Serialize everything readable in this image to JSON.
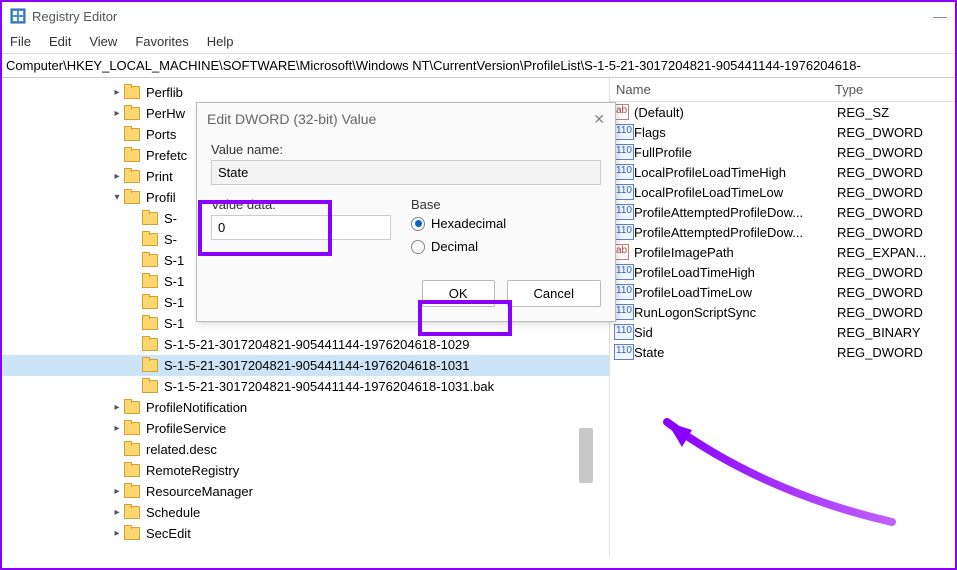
{
  "titlebar": {
    "title": "Registry Editor"
  },
  "menu": {
    "file": "File",
    "edit": "Edit",
    "view": "View",
    "favorites": "Favorites",
    "help": "Help"
  },
  "addressbar": "Computer\\HKEY_LOCAL_MACHINE\\SOFTWARE\\Microsoft\\Windows NT\\CurrentVersion\\ProfileList\\S-1-5-21-3017204821-905441144-1976204618-",
  "tree": {
    "items": [
      {
        "label": "Perflib",
        "indent": 6,
        "chevron": "right"
      },
      {
        "label": "PerHw",
        "indent": 6,
        "chevron": "right"
      },
      {
        "label": "Ports",
        "indent": 6,
        "chevron": ""
      },
      {
        "label": "Prefetc",
        "indent": 6,
        "chevron": ""
      },
      {
        "label": "Print",
        "indent": 6,
        "chevron": "right"
      },
      {
        "label": "Profil",
        "indent": 6,
        "chevron": "down"
      },
      {
        "label": "S-",
        "indent": 7,
        "chevron": ""
      },
      {
        "label": "S-",
        "indent": 7,
        "chevron": ""
      },
      {
        "label": "S-1",
        "indent": 7,
        "chevron": ""
      },
      {
        "label": "S-1",
        "indent": 7,
        "chevron": ""
      },
      {
        "label": "S-1",
        "indent": 7,
        "chevron": ""
      },
      {
        "label": "S-1",
        "indent": 7,
        "chevron": ""
      },
      {
        "label": "S-1-5-21-3017204821-905441144-1976204618-1029",
        "indent": 7,
        "chevron": ""
      },
      {
        "label": "S-1-5-21-3017204821-905441144-1976204618-1031",
        "indent": 7,
        "chevron": "",
        "selected": true
      },
      {
        "label": "S-1-5-21-3017204821-905441144-1976204618-1031.bak",
        "indent": 7,
        "chevron": ""
      },
      {
        "label": "ProfileNotification",
        "indent": 6,
        "chevron": "right"
      },
      {
        "label": "ProfileService",
        "indent": 6,
        "chevron": "right"
      },
      {
        "label": "related.desc",
        "indent": 6,
        "chevron": ""
      },
      {
        "label": "RemoteRegistry",
        "indent": 6,
        "chevron": ""
      },
      {
        "label": "ResourceManager",
        "indent": 6,
        "chevron": "right"
      },
      {
        "label": "Schedule",
        "indent": 6,
        "chevron": "right"
      },
      {
        "label": "SecEdit",
        "indent": 6,
        "chevron": "right"
      }
    ]
  },
  "list": {
    "cols": {
      "name": "Name",
      "type": "Type"
    },
    "rows": [
      {
        "icon": "string",
        "name": "(Default)",
        "type": "REG_SZ"
      },
      {
        "icon": "dword",
        "name": "Flags",
        "type": "REG_DWORD"
      },
      {
        "icon": "dword",
        "name": "FullProfile",
        "type": "REG_DWORD"
      },
      {
        "icon": "dword",
        "name": "LocalProfileLoadTimeHigh",
        "type": "REG_DWORD"
      },
      {
        "icon": "dword",
        "name": "LocalProfileLoadTimeLow",
        "type": "REG_DWORD"
      },
      {
        "icon": "dword",
        "name": "ProfileAttemptedProfileDow...",
        "type": "REG_DWORD"
      },
      {
        "icon": "dword",
        "name": "ProfileAttemptedProfileDow...",
        "type": "REG_DWORD"
      },
      {
        "icon": "string",
        "name": "ProfileImagePath",
        "type": "REG_EXPAN..."
      },
      {
        "icon": "dword",
        "name": "ProfileLoadTimeHigh",
        "type": "REG_DWORD"
      },
      {
        "icon": "dword",
        "name": "ProfileLoadTimeLow",
        "type": "REG_DWORD"
      },
      {
        "icon": "dword",
        "name": "RunLogonScriptSync",
        "type": "REG_DWORD"
      },
      {
        "icon": "dword",
        "name": "Sid",
        "type": "REG_BINARY"
      },
      {
        "icon": "dword",
        "name": "State",
        "type": "REG_DWORD"
      }
    ]
  },
  "dialog": {
    "title": "Edit DWORD (32-bit) Value",
    "value_name_label": "Value name:",
    "value_name": "State",
    "value_data_label": "Value data:",
    "value_data": "0",
    "base_label": "Base",
    "hex": "Hexadecimal",
    "dec": "Decimal",
    "ok": "OK",
    "cancel": "Cancel"
  }
}
